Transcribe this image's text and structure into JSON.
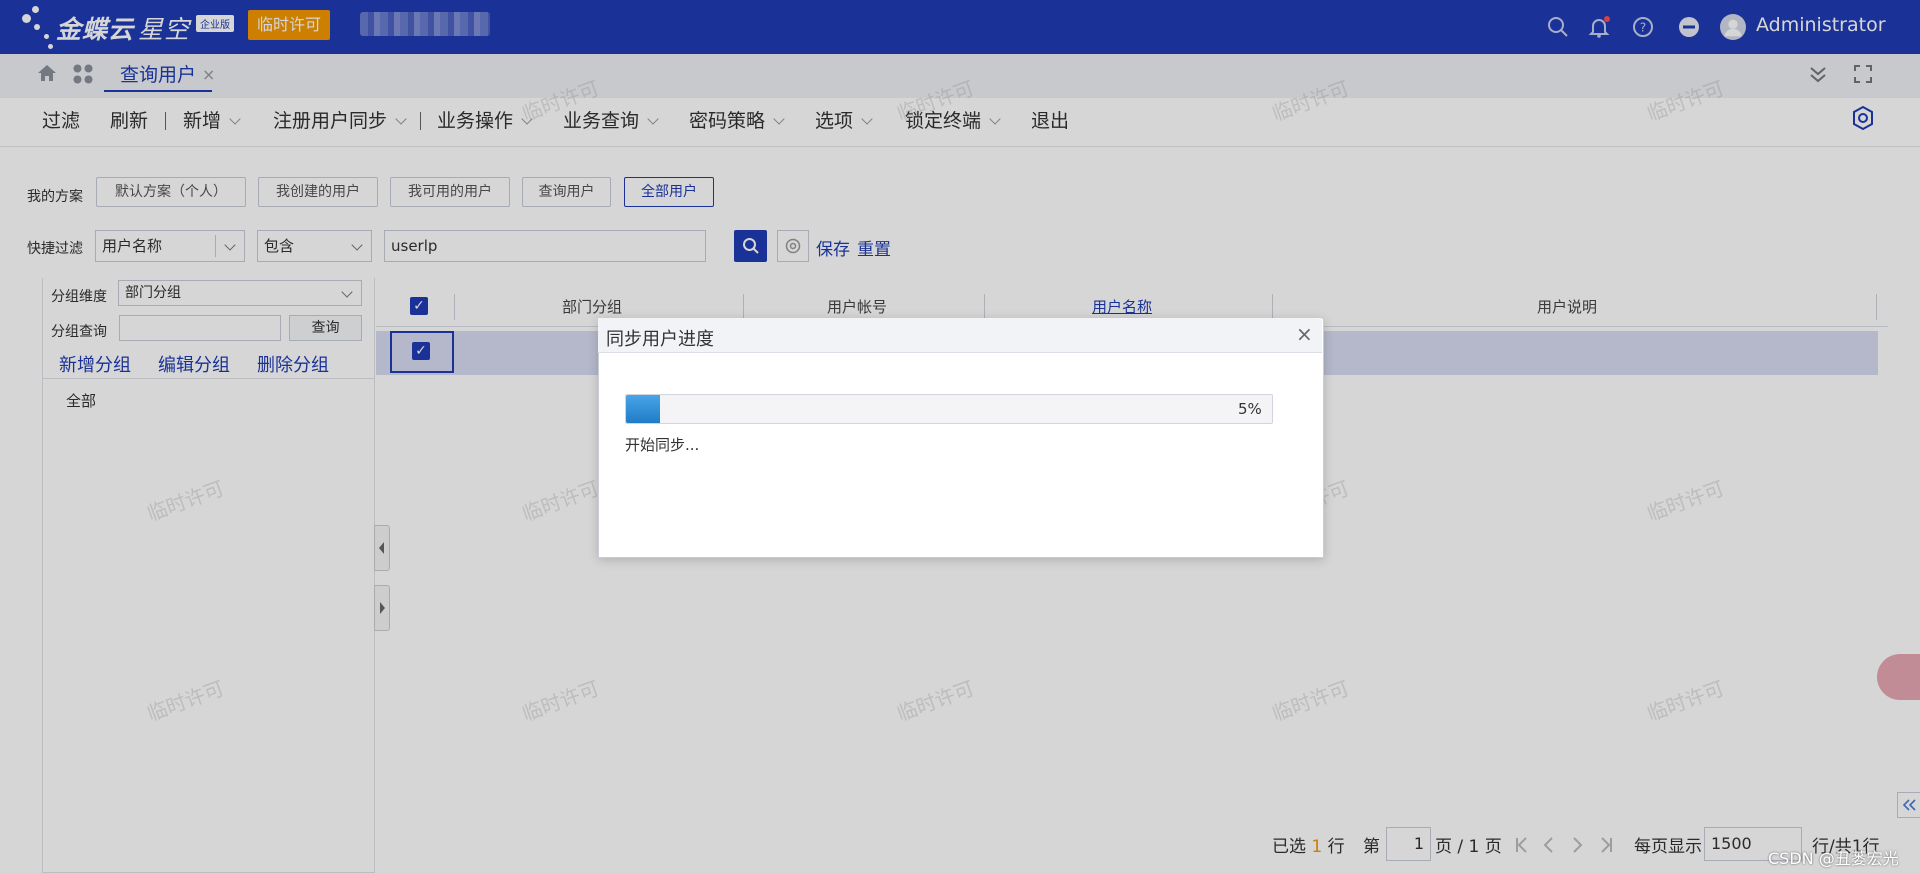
{
  "header": {
    "brand": "金蝶云",
    "brand_sub": "星空",
    "edition_badge": "企业版",
    "temp_license": "临时许可",
    "user_name": "Administrator"
  },
  "tabs": {
    "active_label": "查询用户",
    "close_symbol": "×"
  },
  "toolbar": {
    "items": [
      "过滤",
      "刷新",
      "新增",
      "注册用户同步",
      "业务操作",
      "业务查询",
      "密码策略",
      "选项",
      "锁定终端",
      "退出"
    ]
  },
  "scheme": {
    "label": "我的方案",
    "buttons": [
      "默认方案（个人）",
      "我创建的用户",
      "我可用的用户",
      "查询用户",
      "全部用户"
    ],
    "active": "全部用户"
  },
  "quick_filter": {
    "label": "快捷过滤",
    "field": "用户名称",
    "operator": "包含",
    "value": "userlp",
    "save": "保存",
    "reset": "重置"
  },
  "group_panel": {
    "dimension_label": "分组维度",
    "dimension_value": "部门分组",
    "query_label": "分组查询",
    "query_button": "查询",
    "actions": [
      "新增分组",
      "编辑分组",
      "删除分组"
    ],
    "tree_root": "全部"
  },
  "grid": {
    "columns": [
      "部门分组",
      "用户帐号",
      "用户名称",
      "用户说明"
    ],
    "checkbox_mark": "✓"
  },
  "pager": {
    "selected_prefix": "已选",
    "selected_count": "1",
    "selected_suffix": "行",
    "page_prefix": "第",
    "page_value": "1",
    "page_suffix": "页 / 1 页",
    "per_page_label": "每页显示",
    "per_page_value": "1500",
    "total": "行/共1行"
  },
  "modal": {
    "title": "同步用户进度",
    "close_symbol": "×",
    "progress_percent": "5%",
    "progress_fraction": 0.05,
    "status": "开始同步..."
  },
  "watermark_text": "临时许可",
  "csdn_credit": "CSDN @丑蒌宏光",
  "colors": {
    "header_bg": "#1f3cb4",
    "license_badge": "#f39800",
    "progress": "#2b8bd6"
  }
}
